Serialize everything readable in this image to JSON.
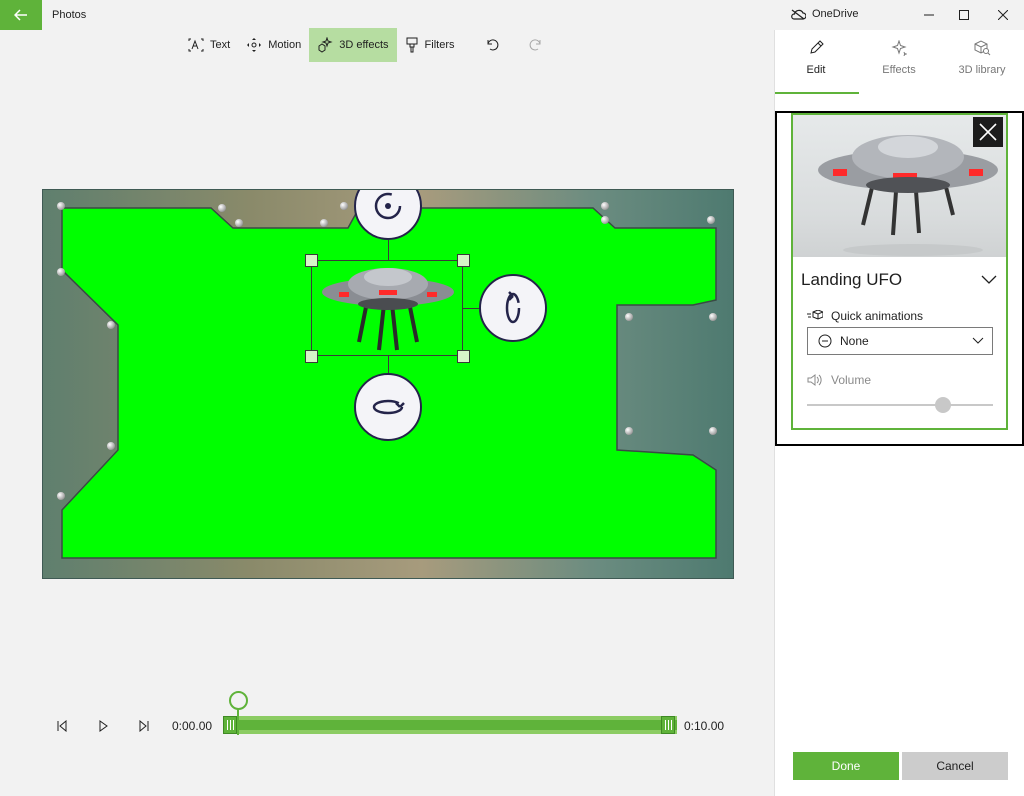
{
  "window": {
    "app_title": "Photos",
    "account_label": "OneDrive",
    "icons": {
      "back": "arrow-left-icon",
      "cloud": "cloud-icon",
      "minimize": "minimize-icon",
      "maximize": "maximize-icon",
      "close": "close-icon"
    }
  },
  "toolbar": {
    "items": [
      {
        "label": "Text",
        "icon": "text-icon"
      },
      {
        "label": "Motion",
        "icon": "motion-icon"
      },
      {
        "label": "3D effects",
        "icon": "sparkle-3d-icon",
        "active": true
      },
      {
        "label": "Filters",
        "icon": "filter-brush-icon"
      }
    ],
    "undo_icon": "undo-icon",
    "redo_icon": "redo-icon"
  },
  "playback": {
    "current_time": "0:00.00",
    "end_time": "0:10.00",
    "playhead_fraction": 0.03,
    "icons": {
      "previous": "step-back-icon",
      "play": "play-icon",
      "next": "step-forward-icon"
    }
  },
  "panel": {
    "tabs": [
      {
        "label": "Edit",
        "icon": "pencil-icon",
        "active": true
      },
      {
        "label": "Effects",
        "icon": "sparkle-icon"
      },
      {
        "label": "3D library",
        "icon": "cube-search-icon"
      }
    ],
    "effect": {
      "title": "Landing UFO",
      "quick_animations_label": "Quick animations",
      "quick_animations_value": "None",
      "volume_label": "Volume",
      "volume_fraction": 0.73
    },
    "done_label": "Done",
    "cancel_label": "Cancel"
  },
  "colors": {
    "accent": "#5fb33a",
    "green_screen": "#00ff00",
    "active_tool_bg": "#b6dda1"
  }
}
